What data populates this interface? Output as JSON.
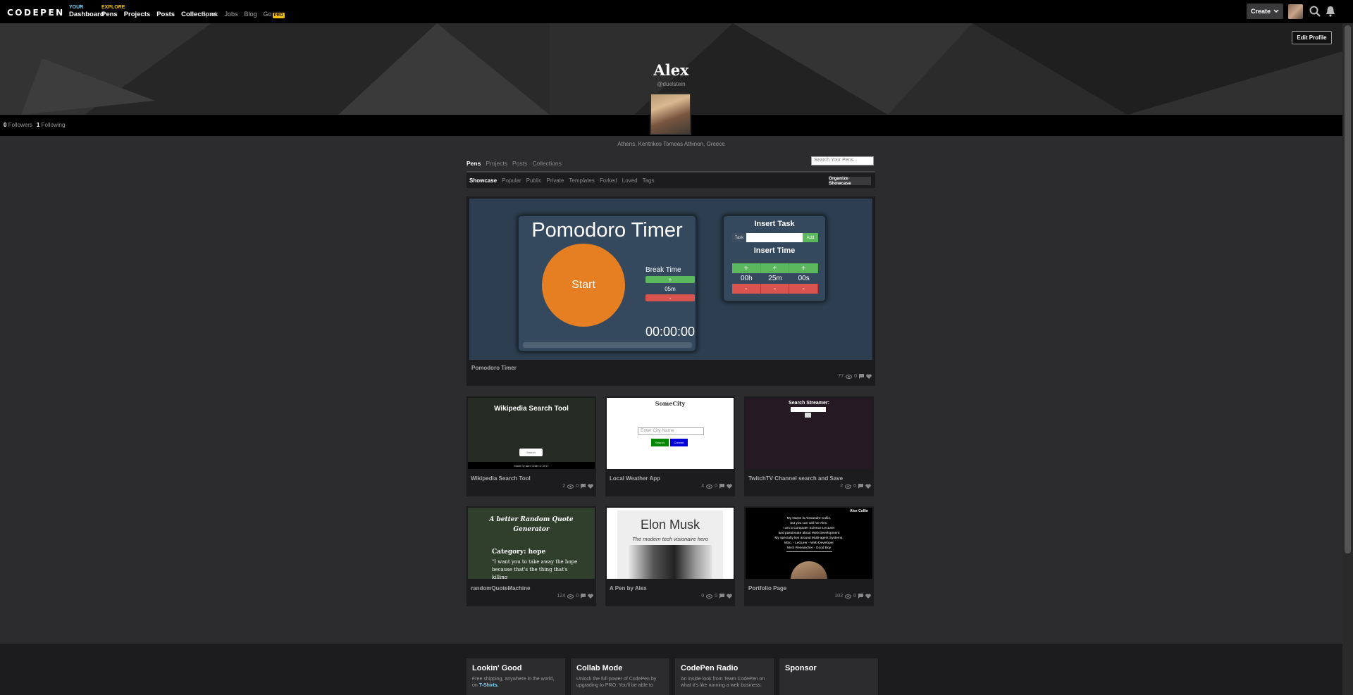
{
  "nav": {
    "logo": "CODEPEN",
    "your_caption": "YOUR",
    "explore_caption": "EXPLORE",
    "dashboard": "Dashboard",
    "pens": "Pens",
    "projects": "Projects",
    "posts": "Posts",
    "collections": "Collections",
    "spark": "Spark",
    "jobs": "Jobs",
    "blog": "Blog",
    "go": "Go",
    "pro_badge": "PRO",
    "create": "Create"
  },
  "profile": {
    "name": "Alex",
    "handle": "@duelstein",
    "edit_profile": "Edit Profile",
    "followers_count": "0",
    "followers_label": "Followers",
    "following_count": "1",
    "following_label": "Following",
    "location": "Athens, Kentrikos Tomeas Athinon, Greece"
  },
  "tabs": {
    "main": [
      "Pens",
      "Projects",
      "Posts",
      "Collections"
    ],
    "search_placeholder": "Search Your Pens...",
    "sub": [
      "Showcase",
      "Popular",
      "Public",
      "Private",
      "Templates",
      "Forked",
      "Loved",
      "Tags"
    ],
    "organize": "Organize Showcase"
  },
  "featured": {
    "title": "Pomodoro Timer",
    "views": "77",
    "comments": "0",
    "preview": {
      "heading": "Pomodoro Timer",
      "start": "Start",
      "break_label": "Break Time",
      "plus": "+",
      "minus": "-",
      "break_value": "05m",
      "clock": "00:00:00",
      "insert_task": "Insert Task",
      "task_label": "Task",
      "add_label": "Add",
      "insert_time": "Insert Time",
      "hours": "00h",
      "minutes": "25m",
      "seconds": "00s"
    }
  },
  "pens": [
    {
      "title": "Wikipedia Search Tool",
      "views": "2",
      "comments": "0",
      "preview_heading": "Wikipedia Search Tool",
      "preview_footer": "Made by Alex Collin © 2017",
      "preview_button": "Search"
    },
    {
      "title": "Local Weather App",
      "views": "4",
      "comments": "0",
      "preview_heading": "SomeCity",
      "preview_placeholder": "Enter City Name",
      "preview_btn1": "Search",
      "preview_btn2": "Convert"
    },
    {
      "title": "TwitchTV Channel search and Save",
      "views": "2",
      "comments": "0",
      "preview_heading": "Search Streamer:"
    },
    {
      "title": "randomQuoteMachine",
      "views": "124",
      "comments": "0",
      "preview_heading": "A better Random Quote Generator",
      "preview_category": "Category: hope",
      "preview_quote": "\"I want you to take away the hope because that's the thing that's killing"
    },
    {
      "title": "A Pen by Alex",
      "views": "0",
      "comments": "0",
      "preview_heading": "Elon Musk",
      "preview_sub": "The modern tech visionaire hero"
    },
    {
      "title": "Portfolio Page",
      "views": "102",
      "comments": "0",
      "preview_name": "Alex Collin",
      "preview_lines": [
        "My Name is Alexandre Collin,",
        "but you can call me Alex.",
        "I am a Computer Science Lecturer",
        "and passionate about Web Development",
        "My specialty lies around Multi-agent Systems.",
        "MSc. - Lecturer - Web Developer",
        "MAS Researcher - Good Boy"
      ]
    }
  ],
  "footer": [
    {
      "title": "Lookin' Good",
      "text": "Free shipping, anywhere in the world, on",
      "link": "T-Shirts."
    },
    {
      "title": "Collab Mode",
      "text": "Unlock the full power of CodePen by upgrading to PRO. You'll be able to"
    },
    {
      "title": "CodePen Radio",
      "text": "An inside look from Team CodePen on what it's like running a web business."
    },
    {
      "title": "Sponsor",
      "text": ""
    }
  ],
  "colors": {
    "accent_pro": "#f0c20f",
    "pomodoro_orange": "#e67e22",
    "green": "#5cb85c",
    "red": "#d9534f"
  }
}
